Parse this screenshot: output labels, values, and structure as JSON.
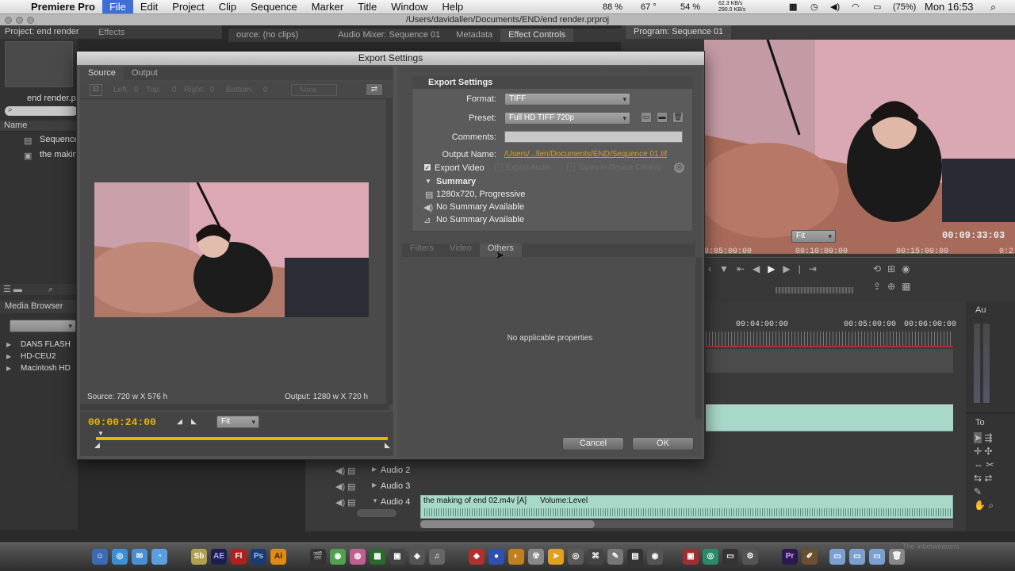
{
  "menubar": {
    "app": "Premiere Pro",
    "items": [
      "File",
      "Edit",
      "Project",
      "Clip",
      "Sequence",
      "Marker",
      "Title",
      "Window",
      "Help"
    ],
    "cpu1": "88 %",
    "cpu2": "67 °",
    "mem": "54 %",
    "net_up": "62.3 KB/s",
    "net_down": "290.0 KB/s",
    "battery": "(75%)",
    "clock": "Mon 16:53"
  },
  "window": {
    "path": "/Users/davidallen/Documents/END/end render.prproj"
  },
  "project_panel": {
    "title": "Project: end render",
    "tab2": "Effects",
    "file_name": "end render.p",
    "col_name": "Name",
    "items": [
      "Sequence",
      "the makin"
    ]
  },
  "media_browser": {
    "title": "Media Browser",
    "drives": [
      "DANS FLASH",
      "HD-CEU2",
      "Macintosh HD"
    ]
  },
  "source_tabs": {
    "items": [
      "ource: (no clips)",
      "Audio Mixer: Sequence 01",
      "Metadata",
      "Effect Controls"
    ]
  },
  "program": {
    "title": "Program: Sequence 01",
    "timecode": "00:09:33:03",
    "fit": "Fit",
    "ruler": [
      "0:05:00:00",
      "00:10:00:00",
      "00:15:00:00",
      "0:2"
    ]
  },
  "timeline": {
    "ruler": [
      "00:04:00:00",
      "00:05:00:00",
      "00:06:00:00"
    ],
    "tracks": [
      "Audio 2",
      "Audio 3",
      "Audio 4"
    ],
    "clip_label": "the making of end 02.m4v [A]",
    "clip_prop": "Volume:Level"
  },
  "export": {
    "title": "Export Settings",
    "tabs": [
      "Source",
      "Output"
    ],
    "crop": {
      "left_lbl": "Left:",
      "left": "0",
      "top_lbl": "Top:",
      "top": "0",
      "right_lbl": "Right:",
      "right": "0",
      "bottom_lbl": "Bottom:",
      "bottom": "0",
      "ratio": "None"
    },
    "source_size": "Source: 720 w X 576 h",
    "output_size": "Output: 1280 w X 720 h",
    "timecode": "00:00:24:00",
    "fit": "Fit",
    "settings": {
      "header": "Export Settings",
      "format_label": "Format:",
      "format": "TIFF",
      "preset_label": "Preset:",
      "preset": "Full HD TIFF 720p",
      "comments_label": "Comments:",
      "comments": "",
      "output_label": "Output Name:",
      "output": "/Users/...llen/Documents/END/Sequence 01.tif",
      "export_video": "Export Video",
      "export_audio": "Export Audio",
      "open_device": "Open in Device Central",
      "summary": "Summary",
      "sum1": "1280x720, Progressive",
      "sum2": "No Summary Available",
      "sum3": "No Summary Available"
    },
    "lower_tabs": [
      "Filters",
      "Video",
      "Others"
    ],
    "no_props": "No applicable properties",
    "cancel": "Cancel",
    "ok": "OK"
  },
  "right_panel": {
    "au": "Au",
    "to": "To"
  },
  "watermark": "The Inbetweeners",
  "dock": [
    "Sb",
    "AE",
    "Fl",
    "Ps",
    "Ai",
    "Pr"
  ],
  "colors": {
    "accent": "#3d6fd6",
    "timecode": "#e8b400",
    "link": "#d4a020",
    "audio_clip": "#a8d8c8"
  }
}
